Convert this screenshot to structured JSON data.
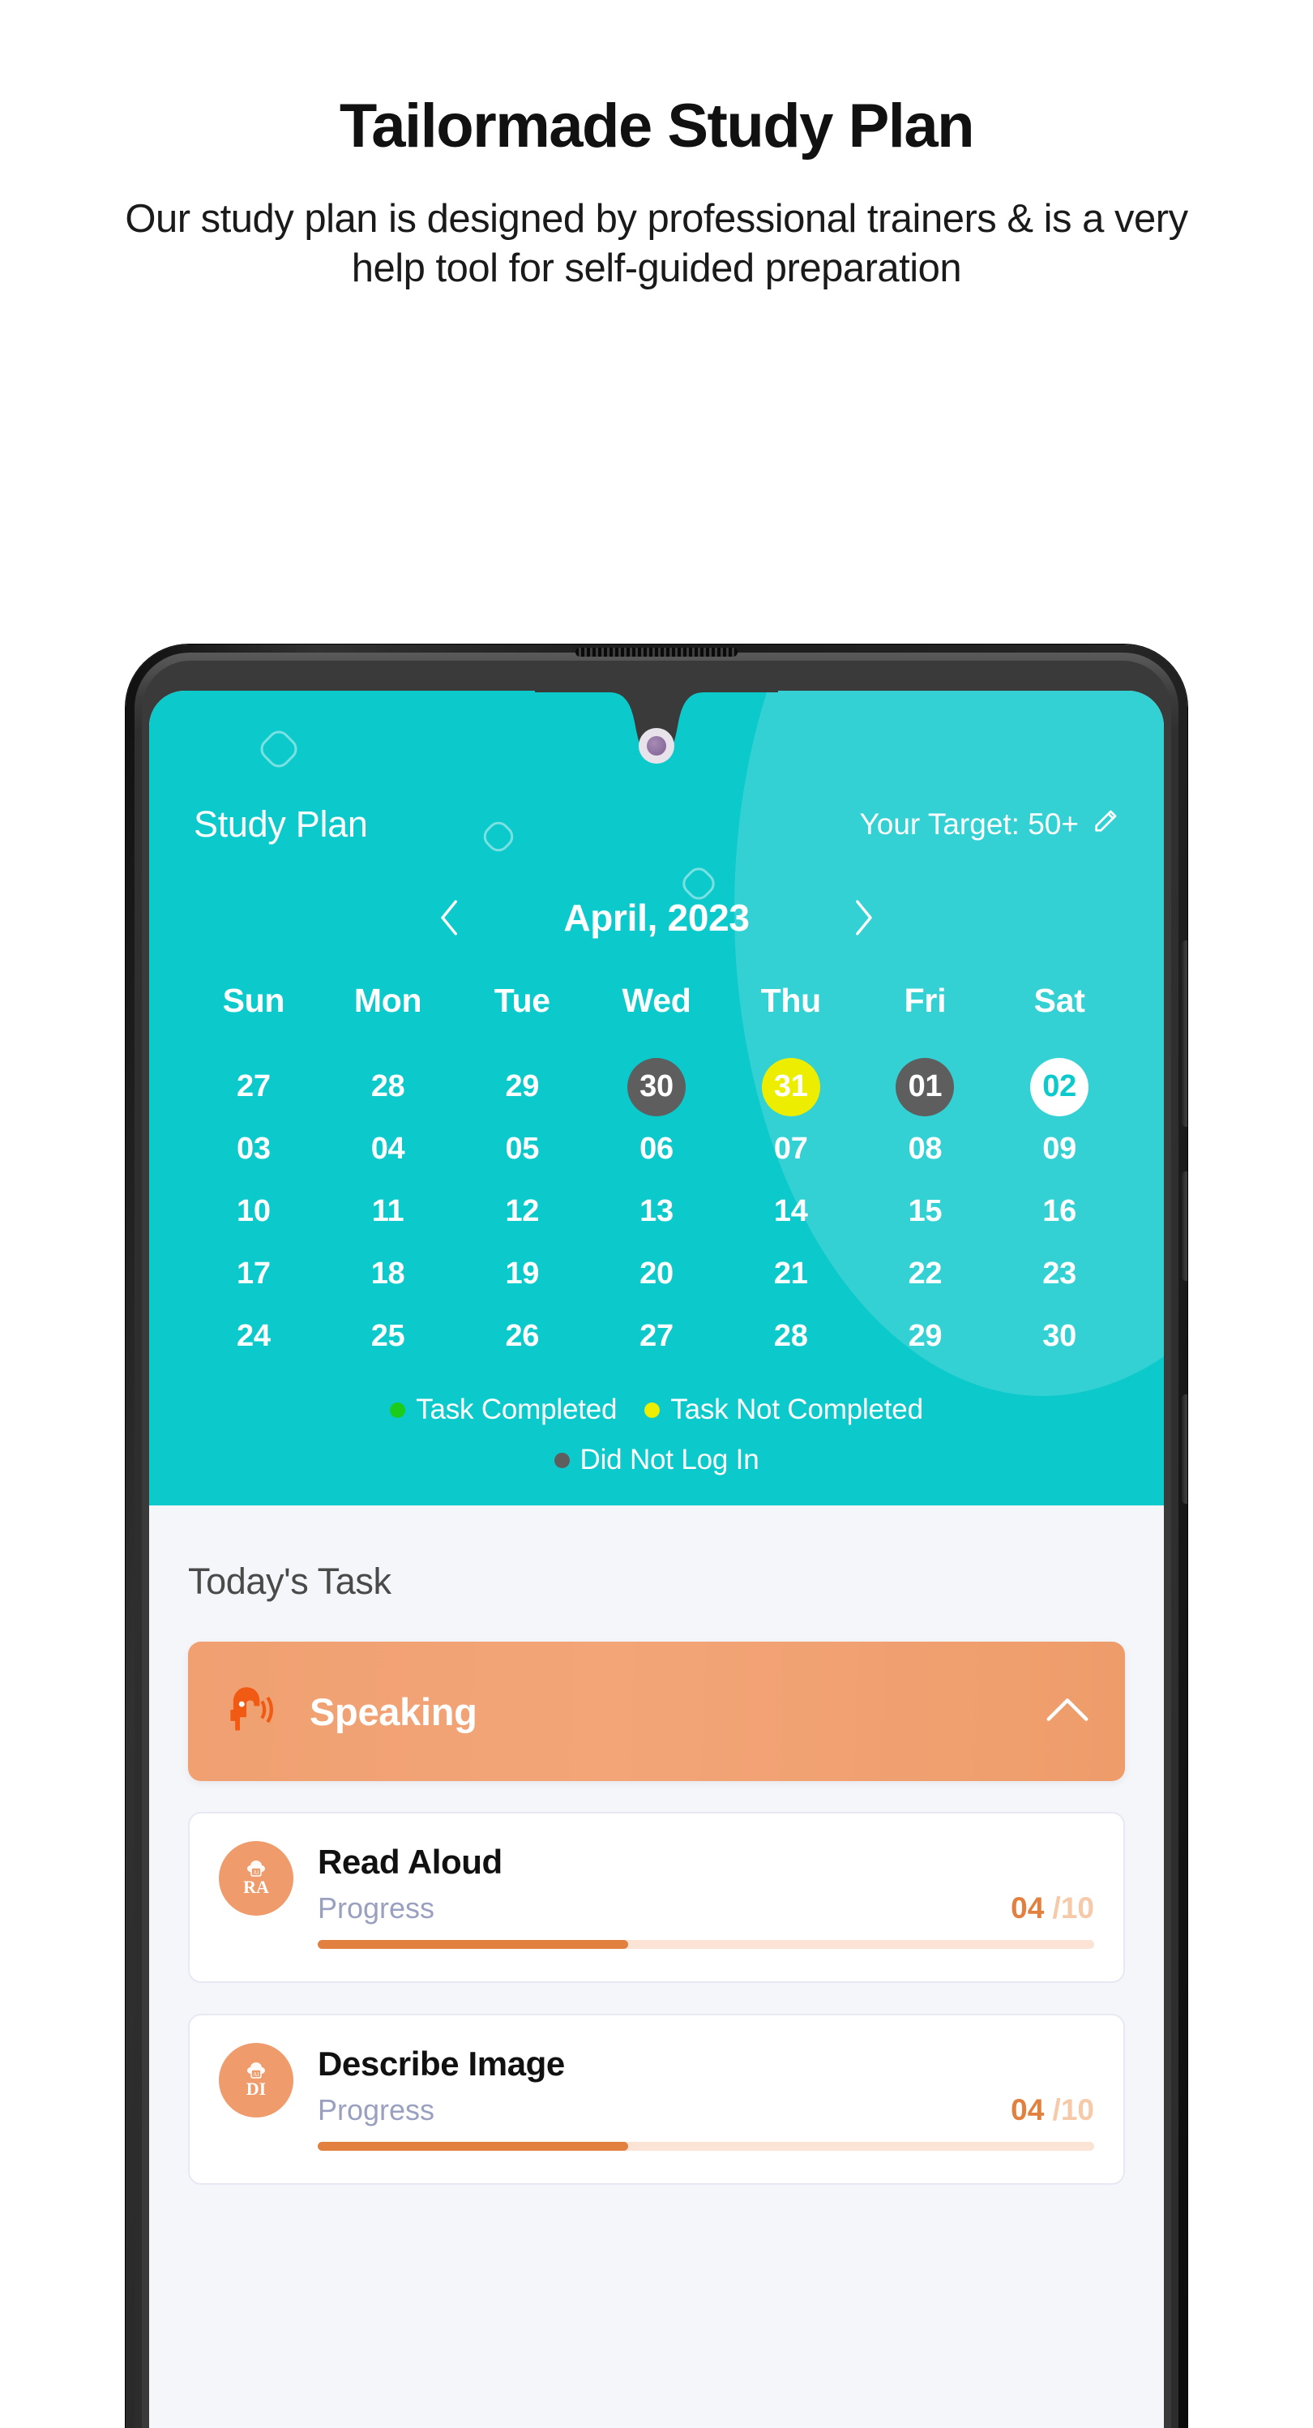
{
  "hero": {
    "title": "Tailormade Study Plan",
    "subtitle": "Our study plan is designed by professional trainers & is a very help tool for self-guided preparation"
  },
  "colors": {
    "teal": "#0cc9cb",
    "teal_light": "#4bd8d8",
    "orange": "#ef9b6b",
    "orange_dark": "#e2803f",
    "yellow": "#eded00",
    "green": "#1ccc1c",
    "gray": "#5e5e5e",
    "body_bg": "#f5f6fa"
  },
  "app": {
    "title": "Study Plan",
    "target_label": "Your Target: 50+",
    "edit_icon": "pencil-icon"
  },
  "calendar": {
    "month": "April, 2023",
    "prev_icon": "chevron-left-icon",
    "next_icon": "chevron-right-icon",
    "weekdays": [
      "Sun",
      "Mon",
      "Tue",
      "Wed",
      "Thu",
      "Fri",
      "Sat"
    ],
    "weeks": [
      [
        {
          "label": "27",
          "state": "plain"
        },
        {
          "label": "28",
          "state": "plain"
        },
        {
          "label": "29",
          "state": "plain"
        },
        {
          "label": "30",
          "state": "gray"
        },
        {
          "label": "31",
          "state": "yellow"
        },
        {
          "label": "01",
          "state": "gray"
        },
        {
          "label": "02",
          "state": "white"
        }
      ],
      [
        {
          "label": "03",
          "state": "plain"
        },
        {
          "label": "04",
          "state": "plain"
        },
        {
          "label": "05",
          "state": "plain"
        },
        {
          "label": "06",
          "state": "plain"
        },
        {
          "label": "07",
          "state": "plain"
        },
        {
          "label": "08",
          "state": "plain"
        },
        {
          "label": "09",
          "state": "plain"
        }
      ],
      [
        {
          "label": "10",
          "state": "plain"
        },
        {
          "label": "11",
          "state": "plain"
        },
        {
          "label": "12",
          "state": "plain"
        },
        {
          "label": "13",
          "state": "plain"
        },
        {
          "label": "14",
          "state": "plain"
        },
        {
          "label": "15",
          "state": "plain"
        },
        {
          "label": "16",
          "state": "plain"
        }
      ],
      [
        {
          "label": "17",
          "state": "plain"
        },
        {
          "label": "18",
          "state": "plain"
        },
        {
          "label": "19",
          "state": "plain"
        },
        {
          "label": "20",
          "state": "plain"
        },
        {
          "label": "21",
          "state": "plain"
        },
        {
          "label": "22",
          "state": "plain"
        },
        {
          "label": "23",
          "state": "plain"
        }
      ],
      [
        {
          "label": "24",
          "state": "plain"
        },
        {
          "label": "25",
          "state": "plain"
        },
        {
          "label": "26",
          "state": "plain"
        },
        {
          "label": "27",
          "state": "plain"
        },
        {
          "label": "28",
          "state": "plain"
        },
        {
          "label": "29",
          "state": "plain"
        },
        {
          "label": "30",
          "state": "plain"
        }
      ]
    ],
    "legend": [
      {
        "label": "Task Completed",
        "color": "#1ccc1c"
      },
      {
        "label": "Task Not Completed",
        "color": "#eded00"
      },
      {
        "label": "Did Not Log In",
        "color": "#5e5e5e"
      }
    ]
  },
  "today": {
    "heading": "Today's Task",
    "section": {
      "label": "Speaking",
      "icon": "speaking-head-icon",
      "collapse_icon": "chevron-up-icon"
    },
    "tasks": [
      {
        "name": "Read Aloud",
        "avatar": "RA",
        "progress_label": "Progress",
        "progress_value": "04",
        "progress_total": "/10",
        "percent": 40
      },
      {
        "name": "Describe Image",
        "avatar": "DI",
        "progress_label": "Progress",
        "progress_value": "04",
        "progress_total": "/10",
        "percent": 40
      }
    ]
  }
}
